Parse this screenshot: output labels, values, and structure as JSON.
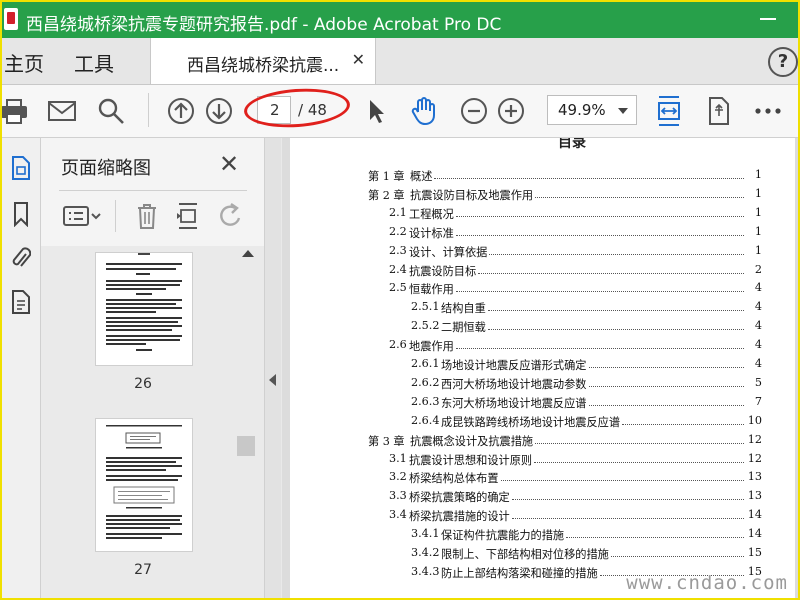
{
  "window": {
    "title": "西昌绕城桥梁抗震专题研究报告.pdf - Adobe Acrobat Pro DC"
  },
  "tabs": {
    "home": "主页",
    "tools": "工具",
    "document": "西昌绕城桥梁抗震...",
    "help_symbol": "?"
  },
  "toolbar": {
    "current_page": "2",
    "total_pages": "/ 48",
    "zoom": "49.9%"
  },
  "icons": [
    "print-icon",
    "mail-icon",
    "search-icon",
    "prev-page-icon",
    "next-page-icon",
    "select-cursor-icon",
    "hand-icon",
    "zoom-out-icon",
    "zoom-in-icon",
    "fit-width-icon",
    "rotate-page-icon",
    "more-icon"
  ],
  "sidebar": {
    "panel_title": "页面缩略图",
    "close_symbol": "✕",
    "thumbnails": [
      {
        "page": "26"
      },
      {
        "page": "27"
      }
    ]
  },
  "document": {
    "heading": "目录",
    "toc": [
      {
        "num": "第 1 章",
        "text": "概述",
        "page": "1",
        "level": 0
      },
      {
        "num": "第 2 章",
        "text": "抗震设防目标及地震作用",
        "page": "1",
        "level": 0
      },
      {
        "num": "2.1",
        "text": "工程概况",
        "page": "1",
        "level": 1
      },
      {
        "num": "2.2",
        "text": "设计标准",
        "page": "1",
        "level": 1
      },
      {
        "num": "2.3",
        "text": "设计、计算依据",
        "page": "1",
        "level": 1
      },
      {
        "num": "2.4",
        "text": "抗震设防目标",
        "page": "2",
        "level": 1
      },
      {
        "num": "2.5",
        "text": "恒载作用",
        "page": "4",
        "level": 1
      },
      {
        "num": "2.5.1",
        "text": "结构自重",
        "page": "4",
        "level": 2
      },
      {
        "num": "2.5.2",
        "text": "二期恒载",
        "page": "4",
        "level": 2
      },
      {
        "num": "2.6",
        "text": "地震作用",
        "page": "4",
        "level": 1
      },
      {
        "num": "2.6.1",
        "text": "场地设计地震反应谱形式确定",
        "page": "4",
        "level": 2
      },
      {
        "num": "2.6.2",
        "text": "西河大桥场地设计地震动参数",
        "page": "5",
        "level": 2
      },
      {
        "num": "2.6.3",
        "text": "东河大桥场地设计地震反应谱",
        "page": "7",
        "level": 2
      },
      {
        "num": "2.6.4",
        "text": "成昆铁路跨线桥场地设计地震反应谱",
        "page": "10",
        "level": 2
      },
      {
        "num": "第 3 章",
        "text": "抗震概念设计及抗震措施",
        "page": "12",
        "level": 0
      },
      {
        "num": "3.1",
        "text": "抗震设计思想和设计原则",
        "page": "12",
        "level": 1
      },
      {
        "num": "3.2",
        "text": "桥梁结构总体布置",
        "page": "13",
        "level": 1
      },
      {
        "num": "3.3",
        "text": "桥梁抗震策略的确定",
        "page": "13",
        "level": 1
      },
      {
        "num": "3.4",
        "text": "桥梁抗震措施的设计",
        "page": "14",
        "level": 1
      },
      {
        "num": "3.4.1",
        "text": "保证构件抗震能力的措施",
        "page": "14",
        "level": 2
      },
      {
        "num": "3.4.2",
        "text": "限制上、下部结构相对位移的措施",
        "page": "15",
        "level": 2
      },
      {
        "num": "3.4.3",
        "text": "防止上部结构落梁和碰撞的措施",
        "page": "15",
        "level": 2
      }
    ]
  },
  "watermark": "www.cndao.com",
  "colors": {
    "title_bar": "#27a04a",
    "accent_blue": "#1f6fd0",
    "annotation_red": "#e0201c",
    "frame_yellow": "#f0e000"
  }
}
